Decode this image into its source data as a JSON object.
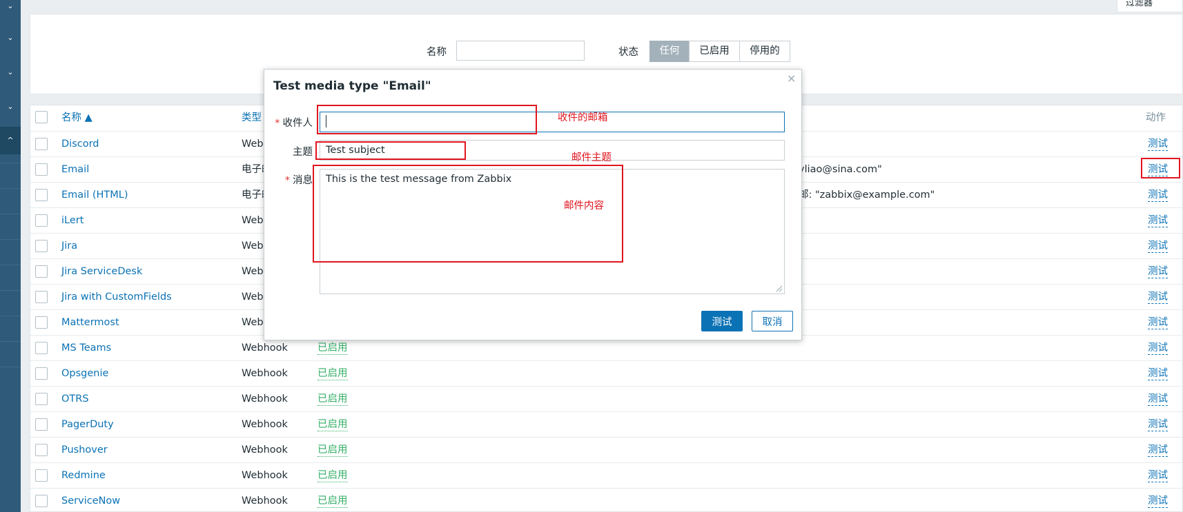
{
  "sidebar": {
    "chevron": "⌄",
    "active_chevron": "^"
  },
  "top_tab": {
    "label": "过滤器"
  },
  "filter": {
    "name_label": "名称",
    "name_value": "",
    "status_label": "状态",
    "status_options": [
      "任何",
      "已启用",
      "停用的"
    ],
    "status_selected": "任何"
  },
  "table": {
    "headers": {
      "name": "名称 ▲",
      "type": "类型",
      "action": "动作"
    },
    "rows": [
      {
        "name": "Discord",
        "type": "Webhook",
        "status": "",
        "extra": "",
        "action": "测试"
      },
      {
        "name": "Email",
        "type": "电子邮件",
        "status": "",
        "extra": "yliao@sina.com\"",
        "action": "测试"
      },
      {
        "name": "Email (HTML)",
        "type": "电子邮件",
        "status": "",
        "extra": "邮: \"zabbix@example.com\"",
        "action": "测试"
      },
      {
        "name": "iLert",
        "type": "Webhook",
        "status": "",
        "extra": "",
        "action": "测试"
      },
      {
        "name": "Jira",
        "type": "Webhook",
        "status": "",
        "extra": "",
        "action": "测试"
      },
      {
        "name": "Jira ServiceDesk",
        "type": "Webhook",
        "status": "",
        "extra": "",
        "action": "测试"
      },
      {
        "name": "Jira with CustomFields",
        "type": "Webhook",
        "status": "",
        "extra": "",
        "action": "测试"
      },
      {
        "name": "Mattermost",
        "type": "Webhook",
        "status": "",
        "extra": "",
        "action": "测试"
      },
      {
        "name": "MS Teams",
        "type": "Webhook",
        "status": "已启用",
        "extra": "",
        "action": "测试"
      },
      {
        "name": "Opsgenie",
        "type": "Webhook",
        "status": "已启用",
        "extra": "",
        "action": "测试"
      },
      {
        "name": "OTRS",
        "type": "Webhook",
        "status": "已启用",
        "extra": "",
        "action": "测试"
      },
      {
        "name": "PagerDuty",
        "type": "Webhook",
        "status": "已启用",
        "extra": "",
        "action": "测试"
      },
      {
        "name": "Pushover",
        "type": "Webhook",
        "status": "已启用",
        "extra": "",
        "action": "测试"
      },
      {
        "name": "Redmine",
        "type": "Webhook",
        "status": "已启用",
        "extra": "",
        "action": "测试"
      },
      {
        "name": "ServiceNow",
        "type": "Webhook",
        "status": "已启用",
        "extra": "",
        "action": "测试"
      }
    ]
  },
  "modal": {
    "title": "Test media type \"Email\"",
    "close": "×",
    "recipient_label": "收件人",
    "recipient_value": "",
    "subject_label": "主题",
    "subject_value": "Test subject",
    "message_label": "消息",
    "message_value": "This is the test message from Zabbix",
    "test_button": "测试",
    "cancel_button": "取消"
  },
  "annotations": {
    "recipient_note": "收件的邮箱",
    "subject_note": "邮件主题",
    "message_note": "邮件内容"
  },
  "colors": {
    "accent": "#0b72b5",
    "enabled": "#34af67",
    "annotation": "#e0141e",
    "sidebar": "#2f5a7a"
  }
}
